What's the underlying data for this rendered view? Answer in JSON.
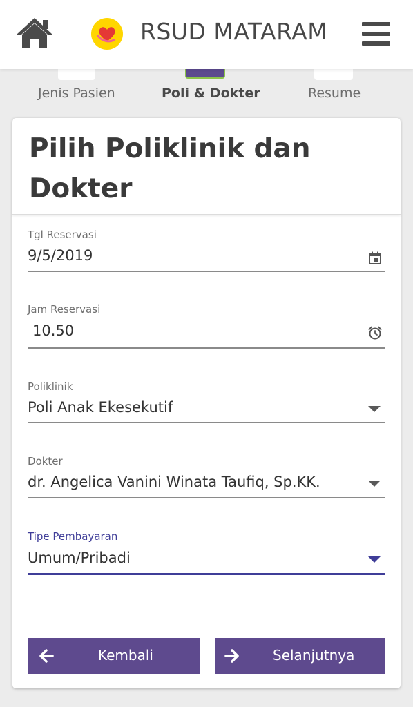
{
  "header": {
    "title": "RSUD MATARAM",
    "home_icon": "home-icon",
    "logo_icon": "heart-hand-logo",
    "menu_icon": "hamburger-menu-icon"
  },
  "steps": [
    {
      "label": "Jenis Pasien",
      "active": false
    },
    {
      "label": "Poli & Dokter",
      "active": true
    },
    {
      "label": "Resume",
      "active": false
    }
  ],
  "card": {
    "title": "Pilih Poliklinik dan Dokter"
  },
  "form": {
    "tgl_reservasi": {
      "label": "Tgl Reservasi",
      "value": "9/5/2019",
      "icon": "calendar-icon"
    },
    "jam_reservasi": {
      "label": "Jam Reservasi",
      "value": "10.50",
      "icon": "alarm-clock-icon"
    },
    "poliklinik": {
      "label": "Poliklinik",
      "value": "Poli Anak Ekesekutif"
    },
    "dokter": {
      "label": "Dokter",
      "value": "dr. Angelica Vanini Winata Taufiq, Sp.KK."
    },
    "tipe_pembayaran": {
      "label": "Tipe Pembayaran",
      "value": "Umum/Pribadi"
    }
  },
  "buttons": {
    "back_label": "Kembali",
    "next_label": "Selanjutnya"
  },
  "colors": {
    "primary": "#5e4a8e",
    "active_field": "#3f3d98",
    "step_indicator_border": "#8bc34a",
    "logo_yellow": "#ffd600",
    "logo_red": "#e53935"
  }
}
